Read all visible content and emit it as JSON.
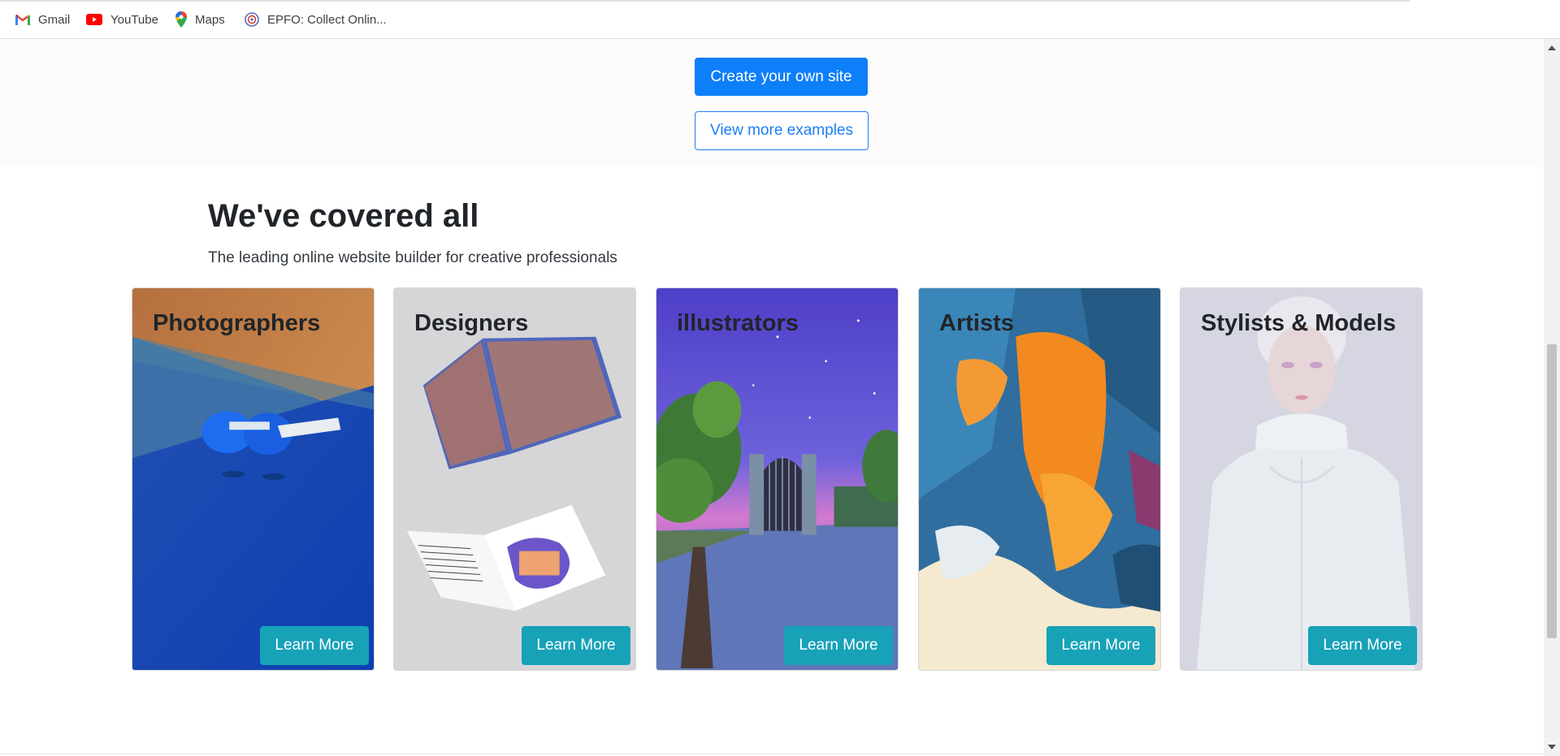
{
  "bookmarks": [
    {
      "label": "Gmail",
      "icon": "gmail-icon"
    },
    {
      "label": "YouTube",
      "icon": "youtube-icon"
    },
    {
      "label": "Maps",
      "icon": "maps-pin-icon"
    },
    {
      "label": "EPFO: Collect Onlin...",
      "icon": "epfo-emblem-icon"
    }
  ],
  "hero": {
    "primary_button": "Create your own site",
    "secondary_button": "View more examples"
  },
  "section": {
    "title": "We've covered all",
    "subtitle": "The leading online website builder for creative professionals"
  },
  "cards": [
    {
      "title": "Photographers",
      "button": "Learn More",
      "image": "blue-sunglasses-photo"
    },
    {
      "title": "Designers",
      "button": "Learn More",
      "image": "printed-brochure-mockup"
    },
    {
      "title": "illustrators",
      "button": "Learn More",
      "image": "night-gate-illustration"
    },
    {
      "title": "Artists",
      "button": "Learn More",
      "image": "abstract-painting"
    },
    {
      "title": "Stylists & Models",
      "button": "Learn More",
      "image": "model-white-coat-photo"
    }
  ],
  "colors": {
    "primary": "#0d7ff9",
    "outline": "#1c7ef2",
    "info": "#17a2b8",
    "text": "#212529"
  }
}
